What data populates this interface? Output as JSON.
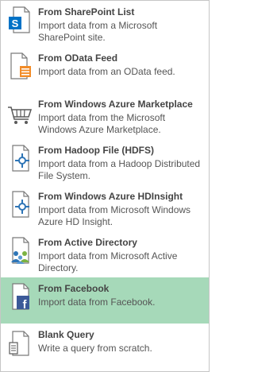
{
  "menu": {
    "items": [
      {
        "title": "From SharePoint List",
        "desc": "Import data from a Microsoft SharePoint site.",
        "icon": "sharepoint-icon"
      },
      {
        "title": "From OData Feed",
        "desc": "Import data from an OData feed.",
        "icon": "odata-feed-icon"
      },
      {
        "title": "From Windows Azure Marketplace",
        "desc": "Import data from the Microsoft Windows Azure Marketplace.",
        "icon": "shopping-cart-icon"
      },
      {
        "title": "From Hadoop File (HDFS)",
        "desc": "Import data from a Hadoop Distributed File System.",
        "icon": "hadoop-file-icon"
      },
      {
        "title": "From Windows Azure HDInsight",
        "desc": "Import data from Microsoft Windows Azure HD Insight.",
        "icon": "hdinsight-icon"
      },
      {
        "title": "From Active Directory",
        "desc": "Import data from Microsoft Active Directory.",
        "icon": "active-directory-icon"
      },
      {
        "title": "From Facebook",
        "desc": "Import data from Facebook.",
        "icon": "facebook-icon"
      },
      {
        "title": "Blank Query",
        "desc": "Write a query from scratch.",
        "icon": "blank-query-icon"
      }
    ],
    "hover_color": "#a6d9b9",
    "border_color": "#c6c6c6"
  }
}
